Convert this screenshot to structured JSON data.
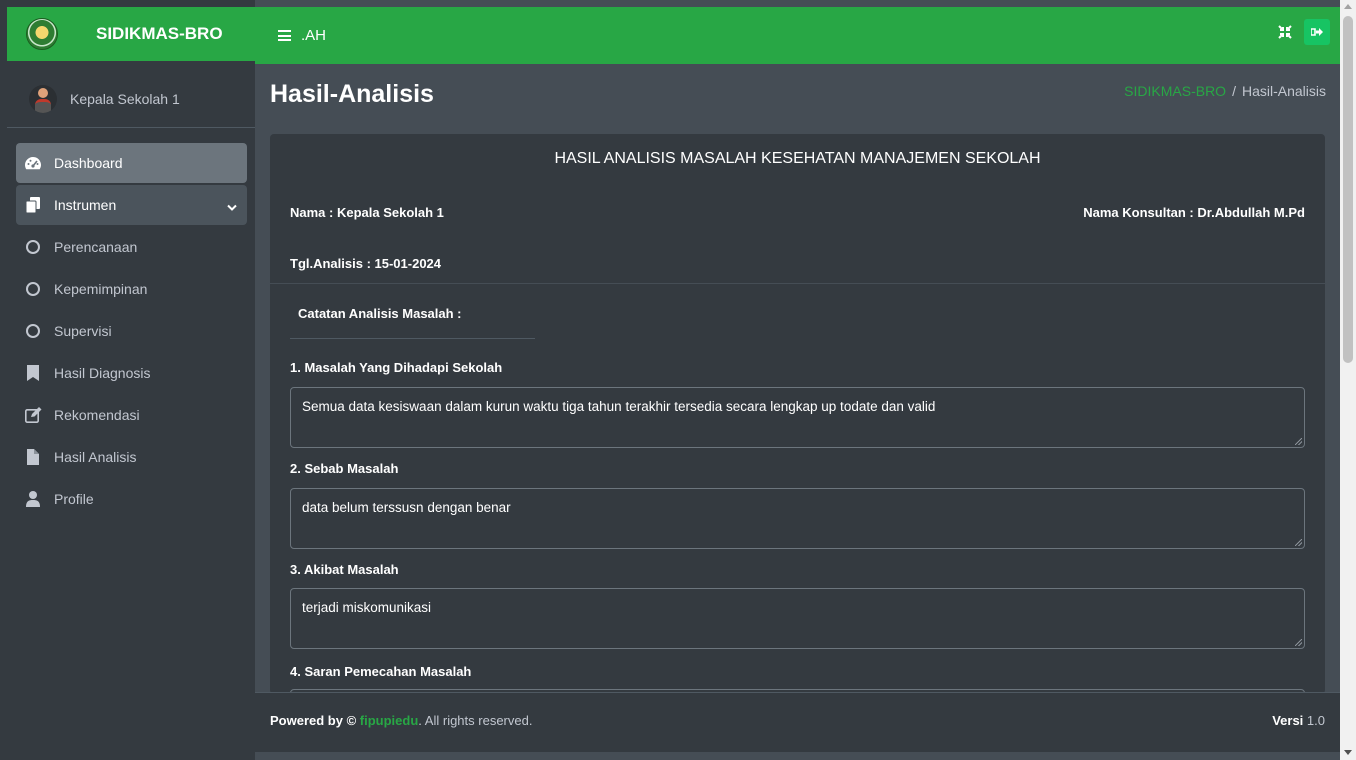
{
  "brand": {
    "name": "SIDIKMAS-BRO"
  },
  "user": {
    "name": "Kepala Sekolah 1"
  },
  "sidebar": {
    "items": [
      {
        "label": "Dashboard",
        "icon": "tachometer-icon",
        "state": "active"
      },
      {
        "label": "Instrumen",
        "icon": "copy-icon",
        "state": "open"
      },
      {
        "label": "Perencanaan",
        "icon": "circle-icon",
        "state": "sub"
      },
      {
        "label": "Kepemimpinan",
        "icon": "circle-icon",
        "state": "sub"
      },
      {
        "label": "Supervisi",
        "icon": "circle-icon",
        "state": "sub"
      },
      {
        "label": "Hasil Diagnosis",
        "icon": "bookmark-icon",
        "state": "normal"
      },
      {
        "label": "Rekomendasi",
        "icon": "edit-icon",
        "state": "normal"
      },
      {
        "label": "Hasil Analisis",
        "icon": "file-icon",
        "state": "normal"
      },
      {
        "label": "Profile",
        "icon": "user-icon",
        "state": "normal"
      }
    ]
  },
  "header": {
    "title": ".AH"
  },
  "page": {
    "title": "Hasil-Analisis",
    "breadcrumb": {
      "home": "SIDIKMAS-BRO",
      "separator": "/",
      "current": "Hasil-Analisis"
    }
  },
  "card": {
    "title": "HASIL ANALISIS MASALAH KESEHATAN MANAJEMEN SEKOLAH",
    "name": "Nama : Kepala Sekolah 1",
    "consultant": "Nama Konsultan : Dr.Abdullah M.Pd",
    "date": "Tgl.Analisis : 15-01-2024",
    "notes_label": "Catatan Analisis Masalah :",
    "questions": [
      {
        "label": "1. Masalah Yang Dihadapi Sekolah",
        "value": "Semua data kesiswaan dalam kurun waktu tiga tahun terakhir tersedia secara lengkap up todate dan valid"
      },
      {
        "label": "2. Sebab Masalah",
        "value": "data belum terssusn dengan benar"
      },
      {
        "label": "3. Akibat Masalah",
        "value": "terjadi miskomunikasi"
      },
      {
        "label": "4. Saran Pemecahan Masalah",
        "value": ""
      }
    ]
  },
  "footer": {
    "powered": "Powered by ©",
    "link": "fipupiedu",
    "rights": ". All rights reserved.",
    "version_label": "Versi",
    "version": "1.0"
  },
  "colors": {
    "accent": "#28a745",
    "sidebar": "#343a40",
    "content": "#454d55"
  }
}
